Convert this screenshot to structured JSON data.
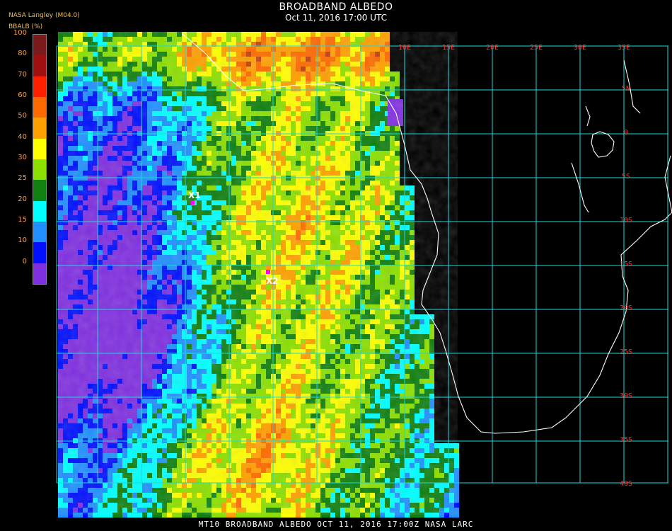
{
  "header": {
    "title": "BROADBAND ALBEDO",
    "subtitle": "Oct 11, 2016 17:00 UTC",
    "source": "NASA Langley (M04.0)",
    "unit_label": "BBALB (%)"
  },
  "footer": {
    "text": "MT10  BROADBAND ALBEDO   OCT 11, 2016 17:00Z   NASA LARC"
  },
  "legend": {
    "ticks": [
      "100",
      "80",
      "70",
      "60",
      "50",
      "40",
      "30",
      "25",
      "20",
      "15",
      "10",
      "0"
    ],
    "colors": [
      "#7a1a1a",
      "#a01010",
      "#ff2000",
      "#ff6a00",
      "#ffa000",
      "#ffff00",
      "#8ce000",
      "#108010",
      "#00ffff",
      "#2090ff",
      "#0010ff",
      "#8030e0"
    ]
  },
  "map": {
    "lon_labels": [
      "10E",
      "15E",
      "20E",
      "25E",
      "30E",
      "35E"
    ],
    "lat_labels": [
      "5N",
      "0",
      "5S",
      "10S",
      "15S",
      "20S",
      "25S",
      "30S",
      "35S",
      "40S"
    ],
    "markers": [
      {
        "label": "X1",
        "color": "#ff00ff"
      },
      {
        "label": "X2",
        "color": "#ff00ff"
      }
    ],
    "colors": {
      "grid": "#20d8d8",
      "coast": "#ffffff",
      "label": "#ff3030"
    }
  }
}
